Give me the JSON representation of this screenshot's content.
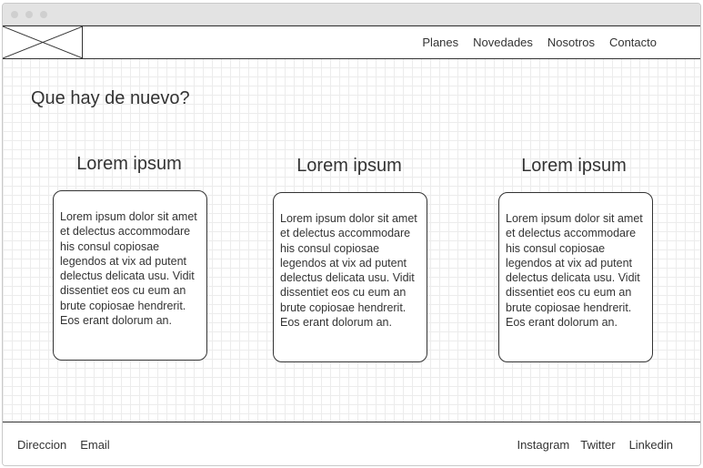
{
  "nav": {
    "links": [
      "Planes",
      "Novedades",
      "Nosotros",
      "Contacto"
    ]
  },
  "main": {
    "heading": "Que hay de nuevo?",
    "columns": [
      {
        "title": "Lorem ipsum",
        "text": "Lorem ipsum dolor sit amet et delectus accommodare his consul copiosae legendos at vix ad putent delectus delicata usu. Vidit dissentiet eos cu eum an brute copiosae hendrerit. Eos erant dolorum an."
      },
      {
        "title": "Lorem ipsum",
        "text": "Lorem ipsum dolor sit amet et delectus accommodare his consul copiosae legendos at vix ad putent delectus delicata usu. Vidit dissentiet eos cu eum an brute copiosae hendrerit. Eos erant dolorum an."
      },
      {
        "title": "Lorem ipsum",
        "text": "Lorem ipsum dolor sit amet et delectus accommodare his consul copiosae legendos at vix ad putent delectus delicata usu. Vidit dissentiet eos cu eum an brute copiosae hendrerit. Eos erant dolorum an."
      }
    ]
  },
  "footer": {
    "left": [
      "Direccion",
      "Email"
    ],
    "right": [
      "Instagram",
      "Twitter",
      "Linkedin"
    ]
  }
}
